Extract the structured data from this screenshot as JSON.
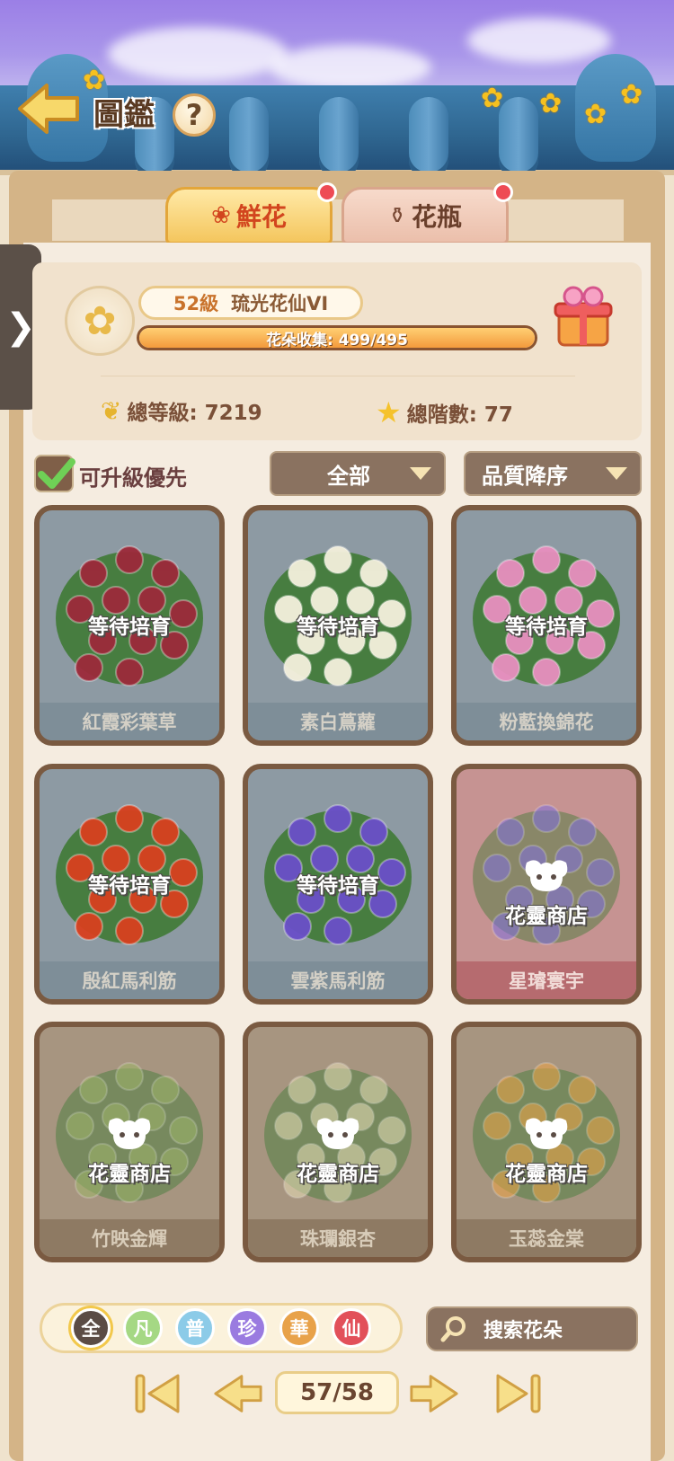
{
  "header": {
    "title": "圖鑑",
    "help_label": "?"
  },
  "tabs": [
    {
      "label": "鮮花",
      "active": true,
      "has_dot": true
    },
    {
      "label": "花瓶",
      "active": false,
      "has_dot": true
    }
  ],
  "side_handle": "❯",
  "profile": {
    "level": "52級",
    "rank": "琉光花仙VI",
    "collection_text": "花朵收集: 499/495",
    "collection_progress": 1.0,
    "total_level": "總等級: 7219",
    "total_steps": "總階數: 77"
  },
  "filters": {
    "upgrade_first_label": "可升級優先",
    "upgrade_first_checked": true,
    "category_label": "全部",
    "sort_label": "品質降序"
  },
  "cards": [
    {
      "name": "紅霞彩葉草",
      "status": "等待培育",
      "style": "grey",
      "flower_color": "#9c2a3a"
    },
    {
      "name": "素白蔦蘿",
      "status": "等待培育",
      "style": "grey",
      "flower_color": "#f4f0dc"
    },
    {
      "name": "粉藍換錦花",
      "status": "等待培育",
      "style": "grey",
      "flower_color": "#e88fbf"
    },
    {
      "name": "殷紅馬利筋",
      "status": "等待培育",
      "style": "grey",
      "flower_color": "#d8401f"
    },
    {
      "name": "雲紫馬利筋",
      "status": "等待培育",
      "style": "grey",
      "flower_color": "#6a4fc8"
    },
    {
      "name": "星璿寰宇",
      "status": "花靈商店",
      "style": "pink",
      "flower_color": "#7f6fe0"
    },
    {
      "name": "竹映金輝",
      "status": "花靈商店",
      "style": "brown",
      "flower_color": "#9fb66a"
    },
    {
      "name": "珠瓓銀杏",
      "status": "花靈商店",
      "style": "brown",
      "flower_color": "#e8dfb8"
    },
    {
      "name": "玉蕊金棠",
      "status": "花靈商店",
      "style": "brown",
      "flower_color": "#f1a545"
    }
  ],
  "rarity_filters": [
    {
      "label": "全",
      "color": "#5b4c45"
    },
    {
      "label": "凡",
      "color": "#a5d884"
    },
    {
      "label": "普",
      "color": "#8ccbe8"
    },
    {
      "label": "珍",
      "color": "#9a7be0"
    },
    {
      "label": "華",
      "color": "#e8a24a"
    },
    {
      "label": "仙",
      "color": "#e2505a"
    }
  ],
  "search": {
    "label": "搜索花朵"
  },
  "pagination": {
    "current": "57/58"
  }
}
